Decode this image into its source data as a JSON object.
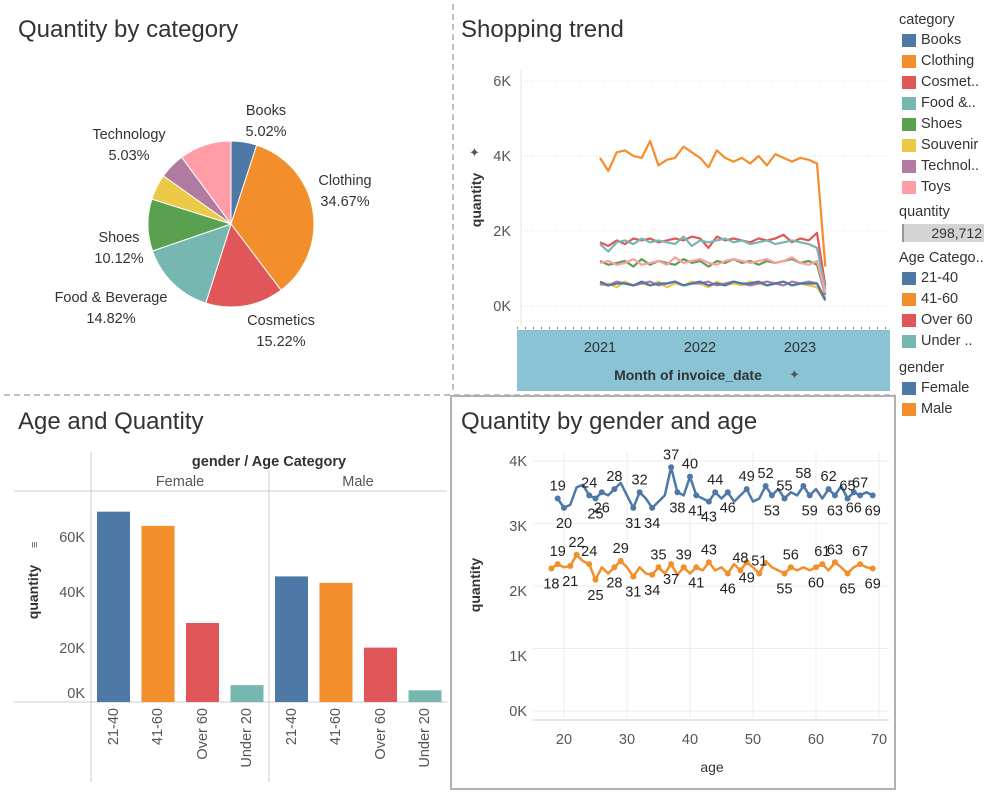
{
  "titles": {
    "pie": "Quantity by category",
    "trend": "Shopping trend",
    "age_qty": "Age and Quantity",
    "gender_age": "Quantity by gender and age"
  },
  "legend": {
    "category_title": "category",
    "categories": [
      {
        "label": "Books",
        "color": "#4e79a7"
      },
      {
        "label": "Clothing",
        "color": "#f28e2b"
      },
      {
        "label": "Cosmet..",
        "color": "#e15759"
      },
      {
        "label": "Food &..",
        "color": "#76b7b2"
      },
      {
        "label": "Shoes",
        "color": "#59a14f"
      },
      {
        "label": "Souvenir",
        "color": "#edc948"
      },
      {
        "label": "Technol..",
        "color": "#b07aa1"
      },
      {
        "label": "Toys",
        "color": "#ff9da7"
      }
    ],
    "quantity_title": "quantity",
    "quantity_value": "298,712",
    "age_title": "Age Catego..",
    "ages": [
      {
        "label": "21-40",
        "color": "#4e79a7"
      },
      {
        "label": "41-60",
        "color": "#f28e2b"
      },
      {
        "label": "Over 60",
        "color": "#e15759"
      },
      {
        "label": "Under ..",
        "color": "#76b7b2"
      }
    ],
    "gender_title": "gender",
    "genders": [
      {
        "label": "Female",
        "color": "#4e79a7"
      },
      {
        "label": "Male",
        "color": "#f28e2b"
      }
    ]
  },
  "chart_data": [
    {
      "type": "pie",
      "title": "Quantity by category",
      "slices": [
        {
          "label": "Books",
          "pct": "5.02%",
          "value": 5.02,
          "color": "#4e79a7"
        },
        {
          "label": "Clothing",
          "pct": "34.67%",
          "value": 34.67,
          "color": "#f28e2b"
        },
        {
          "label": "Cosmetics",
          "pct": "15.22%",
          "value": 15.22,
          "color": "#e15759"
        },
        {
          "label": "Food & Beverage",
          "pct": "14.82%",
          "value": 14.82,
          "color": "#76b7b2"
        },
        {
          "label": "Shoes",
          "pct": "10.12%",
          "value": 10.12,
          "color": "#59a14f"
        },
        {
          "label": "",
          "pct": "",
          "value": 5.0,
          "color": "#edc948"
        },
        {
          "label": "Technology",
          "pct": "5.03%",
          "value": 5.03,
          "color": "#b07aa1"
        },
        {
          "label": "",
          "pct": "",
          "value": 10.12,
          "color": "#ff9da7"
        }
      ]
    },
    {
      "type": "line",
      "title": "Shopping trend",
      "xlabel": "Month of invoice_date",
      "ylabel": "quantity",
      "x_ticks": [
        "2021",
        "2022",
        "2023"
      ],
      "y_ticks": [
        "0K",
        "2K",
        "4K",
        "6K"
      ],
      "ylim": [
        0,
        6000
      ],
      "x_start": "2021-01",
      "series": [
        {
          "color": "#f28e2b",
          "values": [
            3950,
            3600,
            4100,
            4150,
            4000,
            3950,
            4400,
            3750,
            3900,
            3950,
            4250,
            4100,
            3950,
            3700,
            4150,
            3950,
            3850,
            3950,
            3800,
            4000,
            3750,
            4050,
            3950,
            3850,
            3950,
            3900,
            3800,
            1050
          ]
        },
        {
          "color": "#e15759",
          "values": [
            1700,
            1600,
            1750,
            1650,
            1800,
            1750,
            1800,
            1700,
            1750,
            1800,
            1750,
            1850,
            1800,
            1550,
            1850,
            1750,
            1800,
            1750,
            1700,
            1800,
            1750,
            1800,
            1900,
            1700,
            1800,
            1750,
            1950,
            550
          ]
        },
        {
          "color": "#76b7b2",
          "values": [
            1650,
            1450,
            1700,
            1750,
            1650,
            1800,
            1700,
            1750,
            1700,
            1650,
            1850,
            1600,
            1750,
            1700,
            1750,
            1800,
            1700,
            1750,
            1650,
            1700,
            1750,
            1650,
            1700,
            1750,
            1700,
            1650,
            1550,
            450
          ]
        },
        {
          "color": "#59a14f",
          "values": [
            1200,
            1100,
            1150,
            1200,
            1050,
            1250,
            1100,
            1200,
            1150,
            1100,
            1250,
            1150,
            1200,
            1050,
            1200,
            1150,
            1250,
            1150,
            1200,
            1100,
            1200,
            1150,
            1200,
            1250,
            1150,
            1200,
            1100,
            300
          ]
        },
        {
          "color": "#ff9da7",
          "values": [
            1150,
            1200,
            1100,
            1150,
            1250,
            1100,
            1150,
            1200,
            1100,
            1300,
            1150,
            1200,
            1250,
            1150,
            1100,
            1200,
            1250,
            1200,
            1150,
            1200,
            1250,
            1150,
            1200,
            1300,
            1150,
            1100,
            1200,
            350
          ]
        },
        {
          "color": "#edc948",
          "values": [
            550,
            600,
            500,
            650,
            550,
            600,
            550,
            650,
            500,
            600,
            550,
            650,
            600,
            500,
            650,
            550,
            600,
            550,
            650,
            600,
            550,
            600,
            650,
            550,
            600,
            550,
            500,
            150
          ]
        },
        {
          "color": "#b07aa1",
          "values": [
            600,
            550,
            650,
            600,
            550,
            600,
            650,
            550,
            600,
            650,
            550,
            600,
            600,
            650,
            550,
            600,
            650,
            600,
            550,
            600,
            650,
            600,
            550,
            650,
            600,
            650,
            600,
            200
          ]
        },
        {
          "color": "#4e79a7",
          "values": [
            650,
            550,
            600,
            600,
            550,
            650,
            550,
            600,
            600,
            650,
            550,
            600,
            650,
            550,
            600,
            550,
            650,
            600,
            600,
            650,
            550,
            600,
            650,
            550,
            600,
            600,
            600,
            150
          ]
        }
      ]
    },
    {
      "type": "bar",
      "title": "Age and Quantity",
      "header": "gender  /  Age Category",
      "groups": [
        "Female",
        "Male"
      ],
      "categories": [
        "21-40",
        "41-60",
        "Over 60",
        "Under 20"
      ],
      "colors": [
        "#4e79a7",
        "#f28e2b",
        "#e15759",
        "#76b7b2"
      ],
      "series": [
        {
          "name": "Female",
          "values": [
            73500,
            68000,
            30500,
            6500
          ]
        },
        {
          "name": "Male",
          "values": [
            48500,
            46000,
            21000,
            4500
          ]
        }
      ],
      "ylabel": "quantity",
      "y_ticks": [
        "0K",
        "20K",
        "40K",
        "60K"
      ],
      "ylim": [
        0,
        78000
      ]
    },
    {
      "type": "line",
      "title": "Quantity by gender and age",
      "xlabel": "age",
      "ylabel": "quantity",
      "x_ticks": [
        "20",
        "30",
        "40",
        "50",
        "60",
        "70"
      ],
      "y_ticks": [
        "0K",
        "1K",
        "2K",
        "3K",
        "4K"
      ],
      "xlim": [
        16,
        71
      ],
      "ylim": [
        0,
        4000
      ],
      "series": [
        {
          "name": "Female",
          "color": "#4e79a7",
          "x": [
            20,
            19,
            21,
            22,
            23,
            24,
            25,
            26,
            27,
            28,
            29,
            30,
            31,
            32,
            33,
            34,
            35,
            36,
            37,
            38,
            39,
            40,
            41,
            42,
            43,
            44,
            45,
            46,
            47,
            48,
            49,
            50,
            51,
            52,
            53,
            54,
            55,
            56,
            57,
            58,
            59,
            60,
            61,
            62,
            63,
            64,
            65,
            66,
            67,
            68,
            69
          ],
          "values": [
            3250,
            3400,
            3300,
            3580,
            3620,
            3450,
            3400,
            3500,
            3450,
            3550,
            3650,
            3450,
            3250,
            3500,
            3400,
            3250,
            3350,
            3450,
            3900,
            3500,
            3450,
            3750,
            3450,
            3400,
            3350,
            3500,
            3400,
            3500,
            3350,
            3450,
            3550,
            3350,
            3400,
            3600,
            3450,
            3550,
            3400,
            3500,
            3450,
            3600,
            3450,
            3550,
            3400,
            3550,
            3450,
            3600,
            3400,
            3500,
            3450,
            3500,
            3450
          ]
        },
        {
          "name": "Male",
          "color": "#f28e2b",
          "x": [
            18,
            19,
            20,
            21,
            22,
            23,
            24,
            25,
            26,
            27,
            28,
            29,
            30,
            31,
            32,
            33,
            34,
            35,
            36,
            37,
            38,
            39,
            40,
            41,
            42,
            43,
            44,
            45,
            46,
            47,
            48,
            49,
            50,
            51,
            52,
            53,
            54,
            55,
            56,
            57,
            58,
            59,
            60,
            61,
            62,
            63,
            64,
            65,
            66,
            67,
            68,
            69
          ],
          "values": [
            2280,
            2350,
            2300,
            2320,
            2500,
            2400,
            2350,
            2100,
            2300,
            2200,
            2300,
            2400,
            2300,
            2150,
            2300,
            2200,
            2180,
            2300,
            2200,
            2350,
            2180,
            2300,
            2200,
            2300,
            2250,
            2380,
            2250,
            2300,
            2200,
            2350,
            2250,
            2380,
            2300,
            2200,
            2400,
            2300,
            2250,
            2200,
            2300,
            2250,
            2300,
            2250,
            2300,
            2350,
            2250,
            2380,
            2300,
            2200,
            2300,
            2350,
            2300,
            2280
          ]
        }
      ],
      "point_labels": {
        "Female": [
          {
            "t": "19",
            "x": 19,
            "pos": "above"
          },
          {
            "t": "20",
            "x": 20,
            "pos": "below"
          },
          {
            "t": "24",
            "x": 24,
            "pos": "above"
          },
          {
            "t": "25",
            "x": 25,
            "pos": "below"
          },
          {
            "t": "26",
            "x": 26,
            "pos": "below"
          },
          {
            "t": "28",
            "x": 28,
            "pos": "above"
          },
          {
            "t": "31",
            "x": 31,
            "pos": "below"
          },
          {
            "t": "32",
            "x": 32,
            "pos": "above"
          },
          {
            "t": "34",
            "x": 34,
            "pos": "below"
          },
          {
            "t": "37",
            "x": 37,
            "pos": "above"
          },
          {
            "t": "38",
            "x": 38,
            "pos": "below"
          },
          {
            "t": "40",
            "x": 40,
            "pos": "above"
          },
          {
            "t": "41",
            "x": 41,
            "pos": "below"
          },
          {
            "t": "43",
            "x": 43,
            "pos": "below"
          },
          {
            "t": "44",
            "x": 44,
            "pos": "above"
          },
          {
            "t": "46",
            "x": 46,
            "pos": "below"
          },
          {
            "t": "49",
            "x": 49,
            "pos": "above"
          },
          {
            "t": "52",
            "x": 52,
            "pos": "above"
          },
          {
            "t": "53",
            "x": 53,
            "pos": "below"
          },
          {
            "t": "55",
            "x": 55,
            "pos": "above"
          },
          {
            "t": "58",
            "x": 58,
            "pos": "above"
          },
          {
            "t": "59",
            "x": 59,
            "pos": "below"
          },
          {
            "t": "62",
            "x": 62,
            "pos": "above"
          },
          {
            "t": "63",
            "x": 63,
            "pos": "below"
          },
          {
            "t": "65",
            "x": 65,
            "pos": "above"
          },
          {
            "t": "66",
            "x": 66,
            "pos": "below"
          },
          {
            "t": "67",
            "x": 67,
            "pos": "above"
          },
          {
            "t": "69",
            "x": 69,
            "pos": "below"
          }
        ],
        "Male": [
          {
            "t": "18",
            "x": 18,
            "pos": "below"
          },
          {
            "t": "19",
            "x": 19,
            "pos": "above"
          },
          {
            "t": "21",
            "x": 21,
            "pos": "below"
          },
          {
            "t": "22",
            "x": 22,
            "pos": "above"
          },
          {
            "t": "24",
            "x": 24,
            "pos": "above"
          },
          {
            "t": "25",
            "x": 25,
            "pos": "below"
          },
          {
            "t": "28",
            "x": 28,
            "pos": "below"
          },
          {
            "t": "29",
            "x": 29,
            "pos": "above"
          },
          {
            "t": "31",
            "x": 31,
            "pos": "below"
          },
          {
            "t": "34",
            "x": 34,
            "pos": "below"
          },
          {
            "t": "35",
            "x": 35,
            "pos": "above"
          },
          {
            "t": "37",
            "x": 37,
            "pos": "below"
          },
          {
            "t": "39",
            "x": 39,
            "pos": "above"
          },
          {
            "t": "41",
            "x": 41,
            "pos": "below"
          },
          {
            "t": "43",
            "x": 43,
            "pos": "above"
          },
          {
            "t": "46",
            "x": 46,
            "pos": "below"
          },
          {
            "t": "48",
            "x": 48,
            "pos": "above"
          },
          {
            "t": "49",
            "x": 49,
            "pos": "below"
          },
          {
            "t": "51",
            "x": 51,
            "pos": "above"
          },
          {
            "t": "55",
            "x": 55,
            "pos": "below"
          },
          {
            "t": "56",
            "x": 56,
            "pos": "above"
          },
          {
            "t": "60",
            "x": 60,
            "pos": "below"
          },
          {
            "t": "61",
            "x": 61,
            "pos": "above"
          },
          {
            "t": "63",
            "x": 63,
            "pos": "above"
          },
          {
            "t": "65",
            "x": 65,
            "pos": "below"
          },
          {
            "t": "67",
            "x": 67,
            "pos": "above"
          },
          {
            "t": "69",
            "x": 69,
            "pos": "below"
          }
        ]
      }
    }
  ]
}
